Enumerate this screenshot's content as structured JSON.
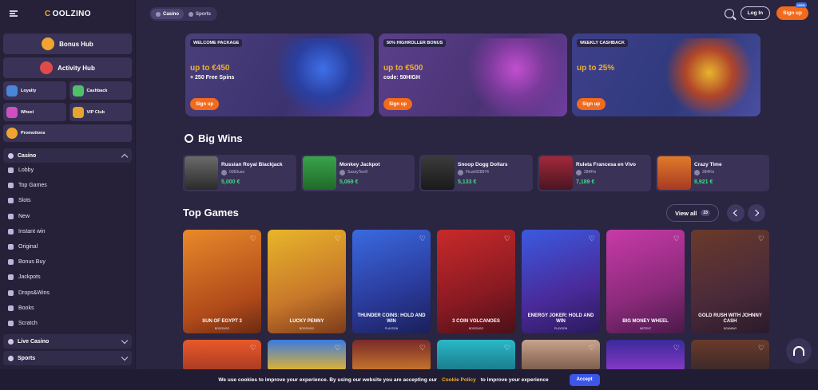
{
  "brand": {
    "name_prefix": "C",
    "name_rest": "OOLZINO"
  },
  "sidebar": {
    "hubs": [
      {
        "label": "Bonus Hub"
      },
      {
        "label": "Activity Hub"
      }
    ],
    "tiles": [
      {
        "label": "Loyalty"
      },
      {
        "label": "Cashback"
      },
      {
        "label": "Wheel"
      },
      {
        "label": "VIP Club"
      }
    ],
    "promotions": "Promotions",
    "casino": "Casino",
    "items": [
      {
        "label": "Lobby"
      },
      {
        "label": "Top Games"
      },
      {
        "label": "Slots"
      },
      {
        "label": "New"
      },
      {
        "label": "Instant win"
      },
      {
        "label": "Original"
      },
      {
        "label": "Bonus Buy"
      },
      {
        "label": "Jackpots"
      },
      {
        "label": "Drops&Wins"
      },
      {
        "label": "Books"
      },
      {
        "label": "Scratch"
      }
    ],
    "live_casino": "Live Casino",
    "sports": "Sports"
  },
  "topbar": {
    "tabs": [
      {
        "label": "Casino"
      },
      {
        "label": "Sports"
      }
    ],
    "login": "Log In",
    "signup": "Sign up",
    "bonus_tag": "100%"
  },
  "banners": [
    {
      "tag": "WELCOME PACKAGE",
      "main": "up to €450",
      "sub": "+ 250 Free Spins",
      "button": "Sign up"
    },
    {
      "tag": "50% HIGHROLLER BONUS",
      "main": "up to €500",
      "sub": "code: 50HIGH",
      "button": "Sign up"
    },
    {
      "tag": "WEEKLY CASHBACK",
      "main": "up to 25%",
      "sub": "",
      "button": "Sign up"
    }
  ],
  "big_wins": {
    "title": "Big Wins",
    "items": [
      {
        "game": "Russian Royal Blackjack",
        "user": "0083use",
        "amount": "5,000 €"
      },
      {
        "game": "Monkey Jackpot",
        "user": "SassyTerr8",
        "amount": "5,069 €"
      },
      {
        "game": "Snoop Dogg Dollars",
        "user": "Flush928974",
        "amount": "5,133 €"
      },
      {
        "game": "Ruleta Francesa en Vivo",
        "user": "284Fin",
        "amount": "7,189 €"
      },
      {
        "game": "Crazy Time",
        "user": "284Fin",
        "amount": "8,921 €"
      }
    ]
  },
  "top_games": {
    "title": "Top Games",
    "view_all": "View all",
    "count": "23",
    "items": [
      {
        "name": "SUN OF EGYPT 3",
        "provider": "BOOONGO"
      },
      {
        "name": "LUCKY PENNY",
        "provider": "BOOONGO"
      },
      {
        "name": "THUNDER COINS: HOLD AND WIN",
        "provider": "PLAYSON"
      },
      {
        "name": "3 COIN VOLCANOES",
        "provider": "BOOONGO"
      },
      {
        "name": "ENERGY JOKER: HOLD AND WIN",
        "provider": "PLAYSON"
      },
      {
        "name": "BIG MONEY WHEEL",
        "provider": "NETENT"
      },
      {
        "name": "GOLD RUSH WITH JOHNNY CASH",
        "provider": "BGAMING"
      }
    ]
  },
  "cookie": {
    "text": "We use cookies to improve your experience. By using our website you are accepting our",
    "link": "Cookie Policy",
    "text2": "to improve your experience",
    "accept": "Accept"
  }
}
